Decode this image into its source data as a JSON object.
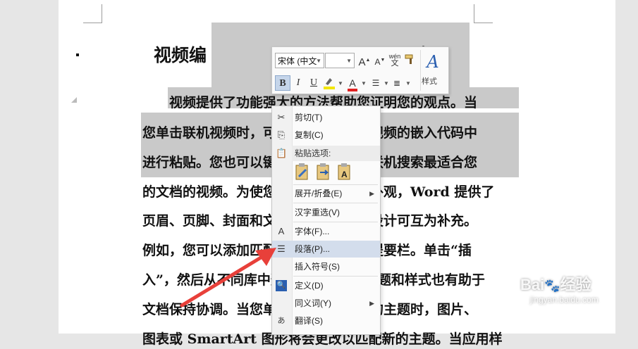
{
  "document": {
    "title": "视频编辑的捷径有功能强大的视频",
    "title_visible_left": "视频编",
    "title_visible_right": "频",
    "lines": [
      "　　视频提供了功能强大的方法帮助您证明您的观点。当",
      "您单击联机视频时，可以在想要添加的视频的嵌入代码中",
      "进行粘贴。您也可以键入一个关键字以联机搜索最适合您",
      "的文档的视频。为使您的文档具有专业外观，Word 提供了",
      "页眉、页脚、封面和文本框设计，这些设计可互为补充。",
      "例如，您可以添加匹配的封面、页眉和提要栏。单击“插",
      "入”，然后从不同库中选择所需元素。主题和样式也有助于",
      "文档保持协调。当您单击设计并选择新的主题时，图片、",
      "图表或 SmartArt 图形将会更改以匹配新的主题。当应用样"
    ]
  },
  "mini_toolbar": {
    "font_name": "宋体 (中文",
    "font_size": "",
    "grow_font": "A",
    "shrink_font": "A",
    "phonetic": "wén",
    "bold": "B",
    "italic": "I",
    "underline": "U",
    "styles_label": "样式",
    "highlight_color": "#f2e600",
    "font_color": "#e02020"
  },
  "context_menu": {
    "items": [
      {
        "label": "剪切(T)",
        "icon": "scissors-icon"
      },
      {
        "label": "复制(C)",
        "icon": "copy-icon"
      },
      {
        "label": "粘贴选项:",
        "icon": "clipboard-icon"
      },
      {
        "label": "展开/折叠(E)",
        "submenu": true
      },
      {
        "label": "汉字重选(V)"
      },
      {
        "label": "字体(F)...",
        "icon": "font-icon"
      },
      {
        "label": "段落(P)...",
        "icon": "paragraph-icon",
        "highlighted": true
      },
      {
        "label": "插入符号(S)"
      },
      {
        "label": "定义(D)",
        "icon": "define-icon"
      },
      {
        "label": "同义词(Y)",
        "submenu": true
      },
      {
        "label": "翻译(S)",
        "icon": "translate-icon"
      }
    ]
  },
  "watermark": {
    "brand": "Bai",
    "brand2": "经验",
    "url": "jingyan.baidu.com"
  },
  "colors": {
    "selection": "#c9c9c9",
    "menu_highlight": "#d3ddec",
    "arrow": "#e8403a"
  }
}
